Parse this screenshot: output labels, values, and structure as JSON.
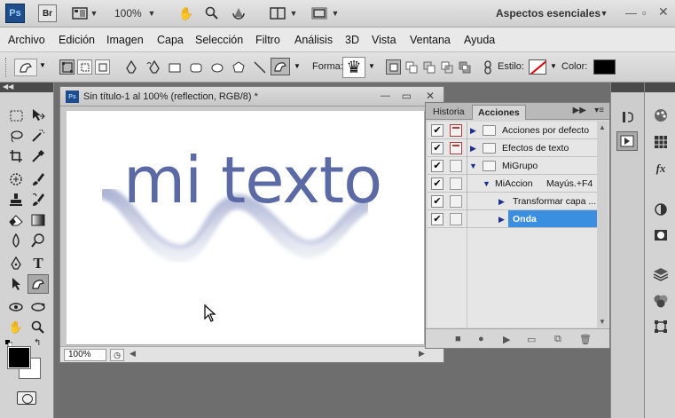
{
  "appbar": {
    "ps_logo": "Ps",
    "br_logo": "Br",
    "zoom": "100%",
    "workspace": "Aspectos esenciales"
  },
  "menu": [
    "Archivo",
    "Edición",
    "Imagen",
    "Capa",
    "Selección",
    "Filtro",
    "Análisis",
    "3D",
    "Vista",
    "Ventana",
    "Ayuda"
  ],
  "options": {
    "shape_label": "Forma:",
    "style_label": "Estilo:",
    "color_label": "Color:",
    "color_value": "#000000"
  },
  "document": {
    "ps_badge": "Ps",
    "title": "Sin título-1 al 100% (reflection, RGB/8) *",
    "canvas_text": "mi texto",
    "zoom_field": "100%"
  },
  "actions_panel": {
    "tab_history": "Historia",
    "tab_actions": "Acciones",
    "rows": [
      {
        "label": "Acciones por defecto",
        "checked": true
      },
      {
        "label": "Efectos de texto",
        "checked": true
      },
      {
        "label": "MiGrupo",
        "checked": true
      },
      {
        "label": "MiAccion",
        "shortcut": "Mayús.+F4",
        "checked": true
      },
      {
        "label": "Transformar capa ...",
        "checked": true
      },
      {
        "label": "Onda",
        "checked": true,
        "selected": true
      }
    ]
  },
  "colors": {
    "text_blue": "#5b6aa4",
    "selection": "#3b8fe0"
  }
}
